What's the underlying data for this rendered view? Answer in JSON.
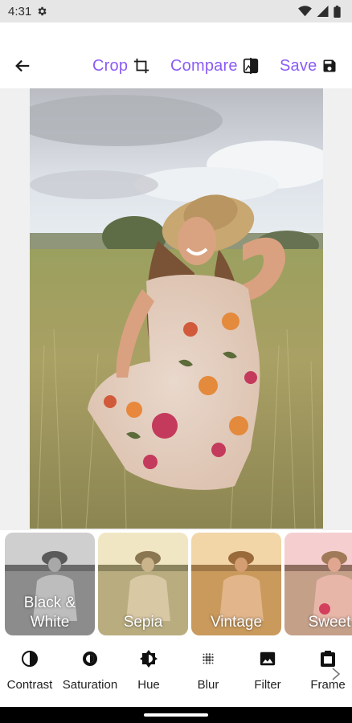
{
  "status_bar": {
    "time": "4:31",
    "icons": [
      "gear-icon",
      "wifi-icon",
      "signal-icon",
      "battery-icon"
    ]
  },
  "toolbar": {
    "back_icon": "arrow-left-icon",
    "crop_label": "Crop",
    "crop_icon": "crop-icon",
    "compare_label": "Compare",
    "compare_icon": "compare-icon",
    "save_label": "Save",
    "save_icon": "floppy-disk-icon"
  },
  "colors": {
    "accent_purple": "#8b5cf6",
    "status_bar_bg": "#e6e6e6",
    "photo_area_bg": "#f0f0f0",
    "text_dark": "#222222"
  },
  "filters": [
    {
      "label_line1": "Black &",
      "label_line2": "White",
      "tint": "grayscale"
    },
    {
      "label_line1": "",
      "label_line2": "Sepia",
      "tint": "sepia-light"
    },
    {
      "label_line1": "",
      "label_line2": "Vintage",
      "tint": "warm"
    },
    {
      "label_line1": "",
      "label_line2": "Sweet",
      "tint": "pink"
    }
  ],
  "tools": [
    {
      "label": "Contrast",
      "icon": "contrast-icon"
    },
    {
      "label": "Saturation",
      "icon": "saturation-icon"
    },
    {
      "label": "Hue",
      "icon": "hue-icon"
    },
    {
      "label": "Blur",
      "icon": "blur-icon"
    },
    {
      "label": "Filter",
      "icon": "image-icon"
    },
    {
      "label": "Frame",
      "icon": "frame-icon"
    }
  ]
}
